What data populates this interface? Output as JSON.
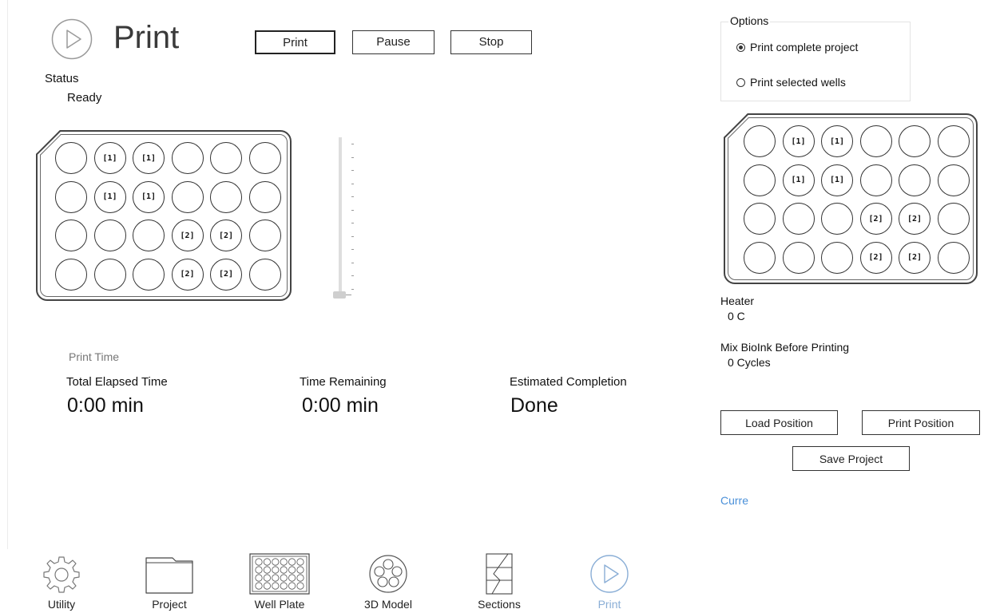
{
  "header": {
    "title": "Print",
    "buttons": {
      "print": "Print",
      "pause": "Pause",
      "stop": "Stop"
    }
  },
  "status": {
    "label": "Status",
    "value": "Ready"
  },
  "left_plate": {
    "rows": [
      [
        "",
        "[1]",
        "[1]",
        "",
        "",
        ""
      ],
      [
        "",
        "[1]",
        "[1]",
        "",
        "",
        ""
      ],
      [
        "",
        "",
        "",
        "[2]",
        "[2]",
        ""
      ],
      [
        "",
        "",
        "",
        "[2]",
        "[2]",
        ""
      ]
    ]
  },
  "right_plate": {
    "rows": [
      [
        "",
        "[1]",
        "[1]",
        "",
        "",
        ""
      ],
      [
        "",
        "[1]",
        "[1]",
        "",
        "",
        ""
      ],
      [
        "",
        "",
        "",
        "[2]",
        "[2]",
        ""
      ],
      [
        "",
        "",
        "",
        "[2]",
        "[2]",
        ""
      ]
    ]
  },
  "slider": {
    "value_fraction": 0.0
  },
  "print_time": {
    "label": "Print Time",
    "elapsed_label": "Total Elapsed Time",
    "elapsed_value": "0:00 min",
    "remaining_label": "Time Remaining",
    "remaining_value": "0:00 min",
    "completion_label": "Estimated Completion",
    "completion_value": "Done"
  },
  "options": {
    "title": "Options",
    "items": [
      {
        "label": "Print complete project",
        "selected": true
      },
      {
        "label": "Print selected wells",
        "selected": false
      }
    ]
  },
  "heater": {
    "label": "Heater",
    "value": "0 C"
  },
  "mix": {
    "label": "Mix BioInk Before Printing",
    "value": "0 Cycles"
  },
  "buttons": {
    "load_position": "Load Position",
    "print_position": "Print Position",
    "save_project": "Save Project"
  },
  "current_text": "Curre",
  "nav": {
    "items": [
      {
        "label": "Utility",
        "icon": "gear-icon"
      },
      {
        "label": "Project",
        "icon": "folder-icon"
      },
      {
        "label": "Well Plate",
        "icon": "well-plate-icon"
      },
      {
        "label": "3D Model",
        "icon": "3d-model-icon"
      },
      {
        "label": "Sections",
        "icon": "sections-icon"
      },
      {
        "label": "Print",
        "icon": "play-circle-icon",
        "active": true
      }
    ],
    "active_color": "#8aaed6"
  },
  "colors": {
    "accent": "#4a90d9"
  }
}
